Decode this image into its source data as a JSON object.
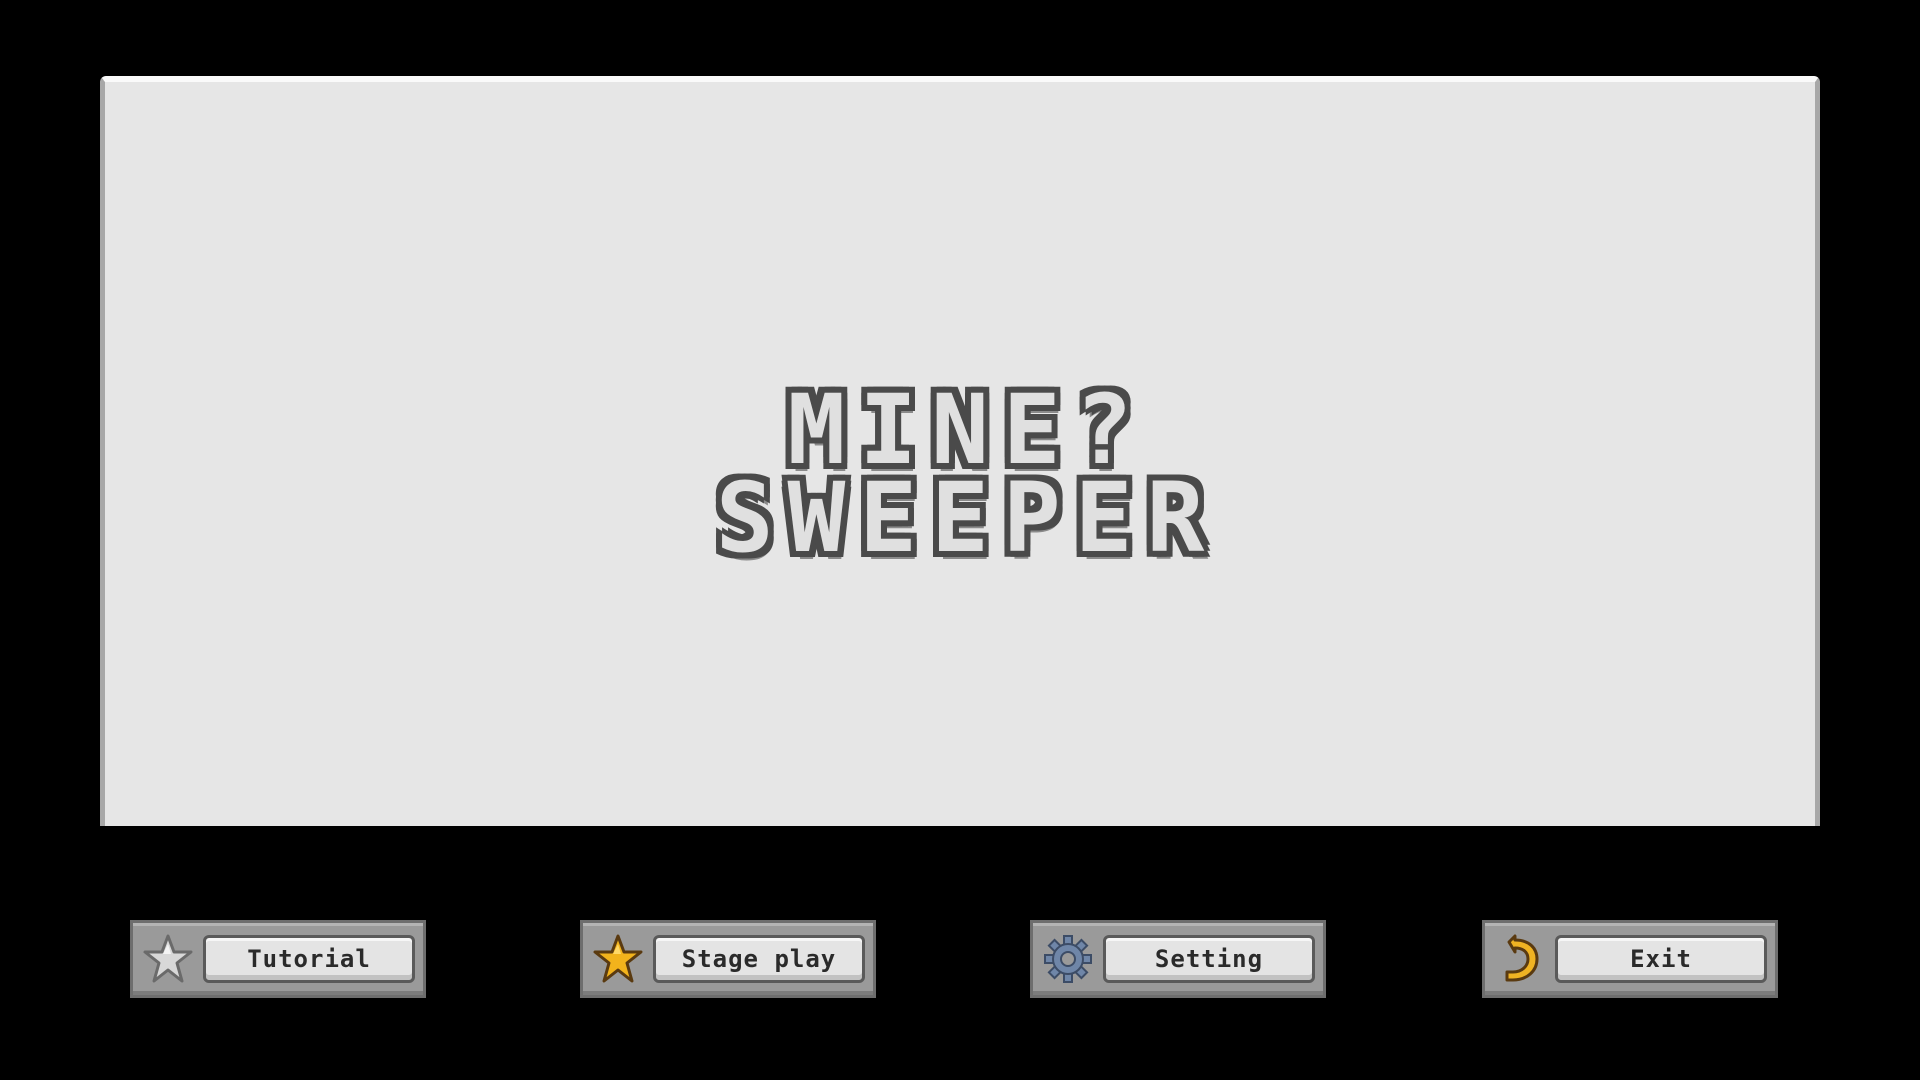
{
  "title": {
    "line1": "MINE?",
    "line2": "SWEEPER"
  },
  "menu": {
    "buttons": [
      {
        "id": "tutorial",
        "label": "Tutorial",
        "icon": "silver-star-icon"
      },
      {
        "id": "stage",
        "label": "Stage play",
        "icon": "gold-star-icon"
      },
      {
        "id": "setting",
        "label": "Setting",
        "icon": "gear-icon"
      },
      {
        "id": "exit",
        "label": "Exit",
        "icon": "return-arrow-icon"
      }
    ]
  },
  "colors": {
    "background": "#000000",
    "panel": "#e6e6e6",
    "title_outline": "#4a4a4a",
    "button_frame": "#9a9a9a",
    "button_label_bg": "#e4e4e4",
    "gold_star": "#f2b31c",
    "silver_star": "#d8d8d8",
    "gear": "#6f86a8",
    "arrow": "#f0b323"
  }
}
